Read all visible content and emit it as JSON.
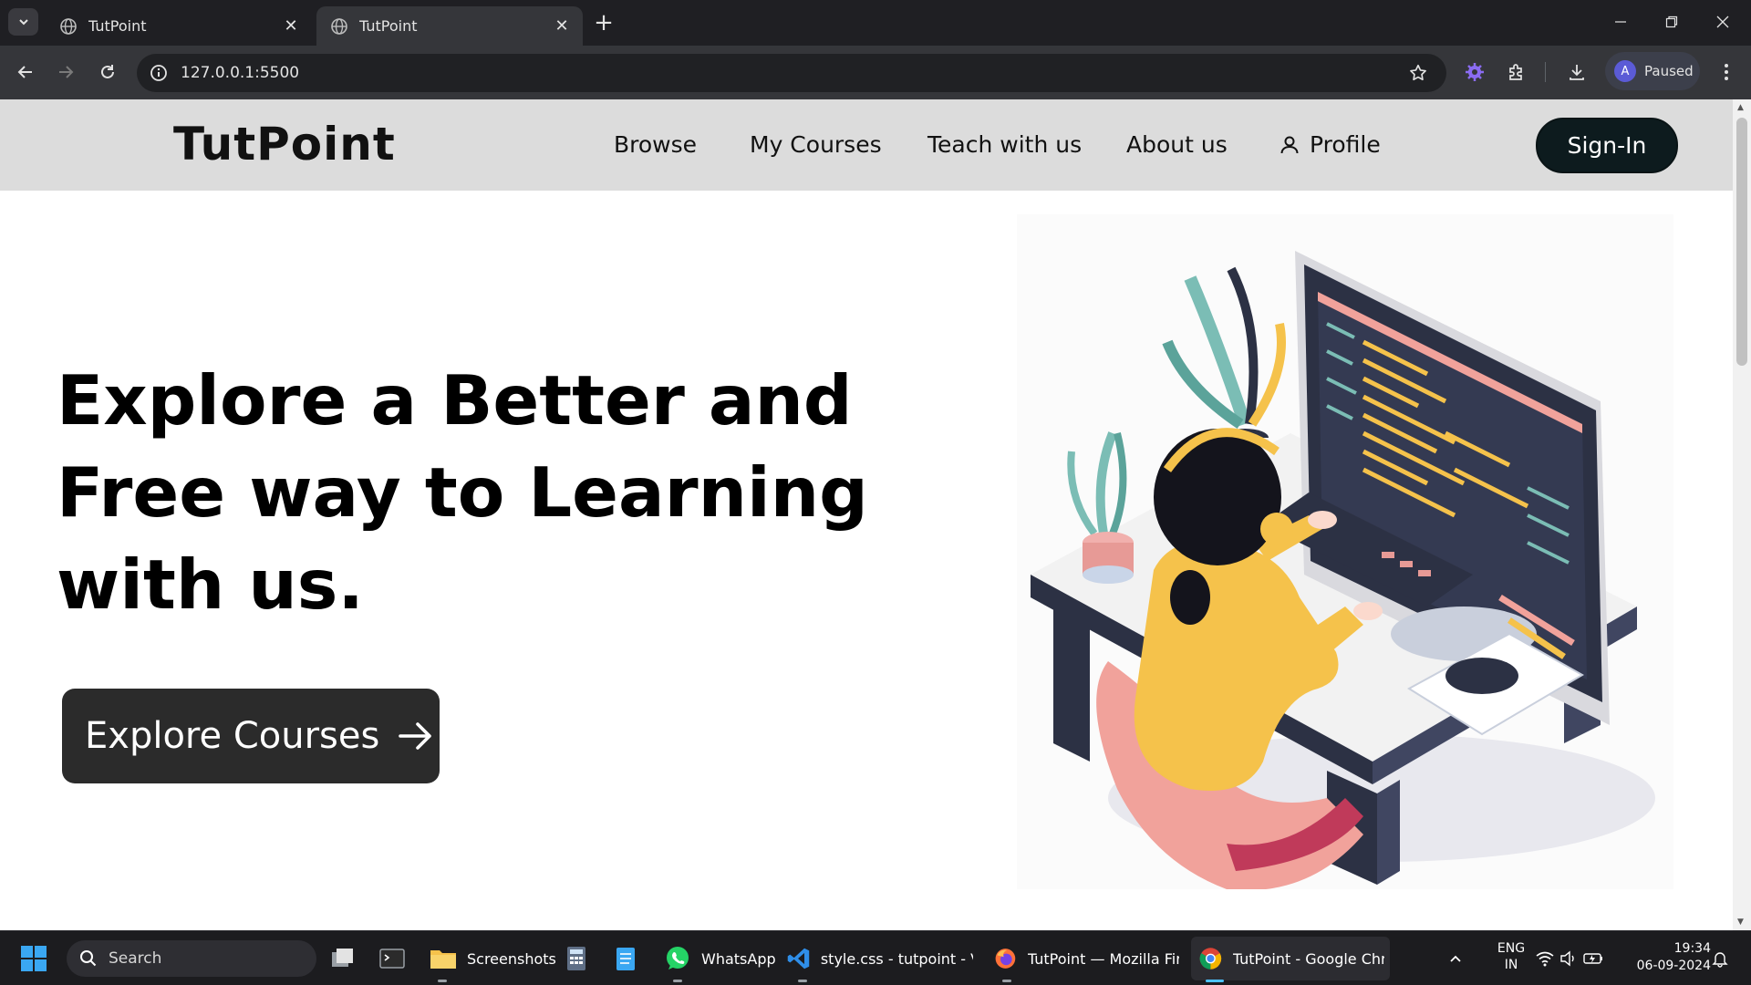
{
  "browser": {
    "tabs": [
      {
        "title": "TutPoint",
        "active": false
      },
      {
        "title": "TutPoint",
        "active": true
      }
    ],
    "url": "127.0.0.1:5500",
    "profile": {
      "initial": "A",
      "status": "Paused"
    }
  },
  "site": {
    "brand": "TutPoint",
    "nav": {
      "browse": "Browse",
      "my_courses": "My Courses",
      "teach": "Teach with us",
      "about": "About us",
      "profile": "Profile",
      "signin": "Sign-In"
    },
    "hero": {
      "title_lines": [
        "Explore a Better and",
        "Free way to Learning",
        "with us."
      ],
      "cta": "Explore Courses"
    }
  },
  "taskbar": {
    "search_placeholder": "Search",
    "apps": [
      {
        "label": "Screenshots"
      },
      {
        "label": "WhatsApp"
      },
      {
        "label": "style.css - tutpoint - Visi"
      },
      {
        "label": "TutPoint — Mozilla Firef"
      },
      {
        "label": "TutPoint - Google Chror"
      }
    ],
    "lang_line1": "ENG",
    "lang_line2": "IN",
    "time": "19:34",
    "date": "06-09-2024"
  },
  "colors": {
    "nav_bg": "#dcdcdc",
    "signin_bg": "#0d1b1e",
    "cta_bg": "#2b2b2b",
    "chrome_dark": "#1f1f23",
    "illustration_yellow": "#f5c24b",
    "illustration_navy": "#2c3144"
  }
}
